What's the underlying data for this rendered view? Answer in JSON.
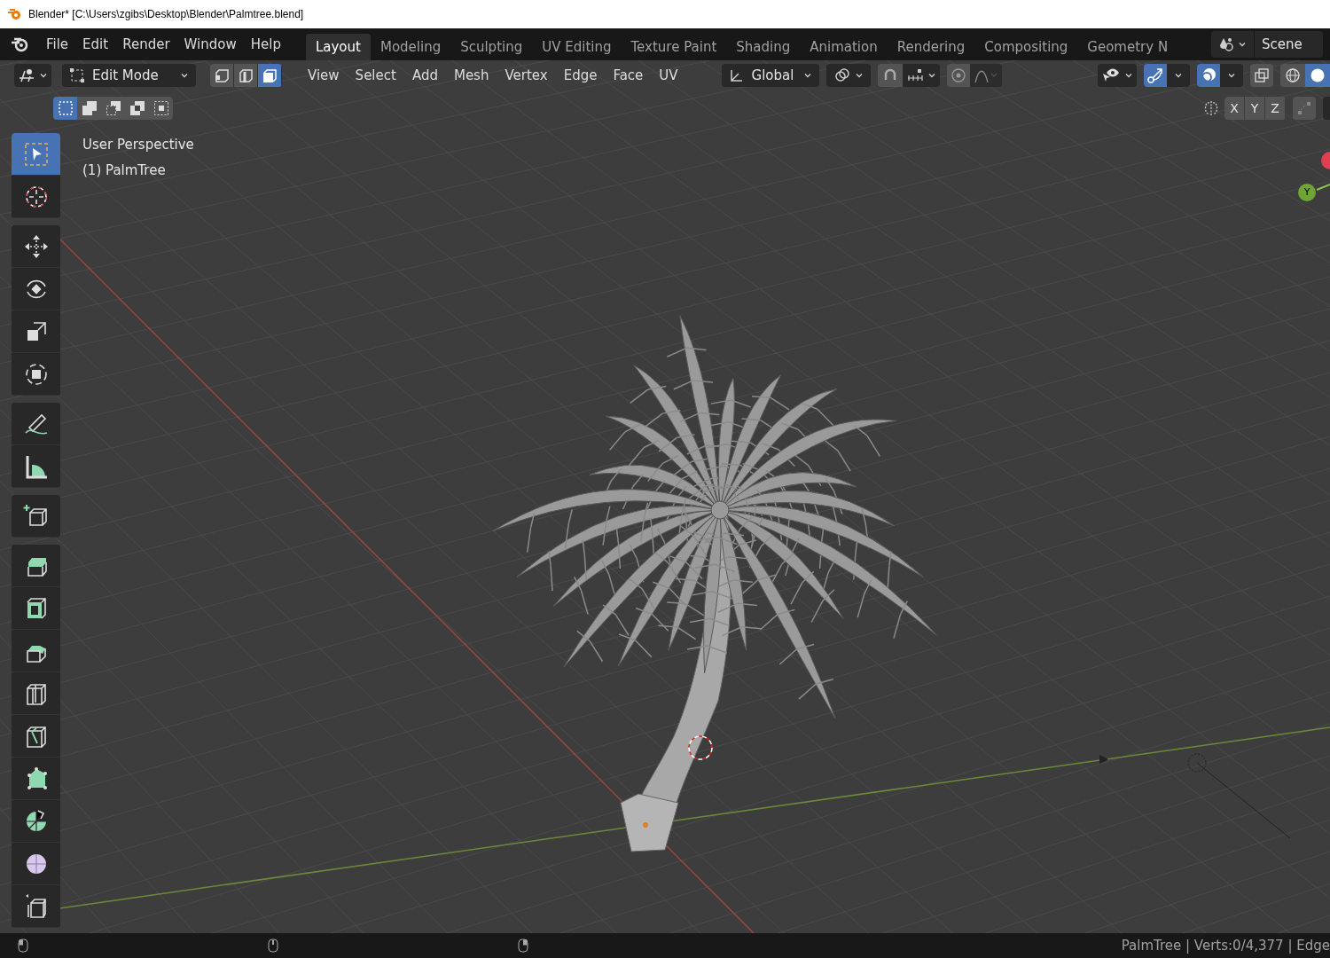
{
  "window": {
    "title": "Blender* [C:\\Users\\zgibs\\Desktop\\Blender\\Palmtree.blend]"
  },
  "menu": [
    "File",
    "Edit",
    "Render",
    "Window",
    "Help"
  ],
  "workspaces": [
    {
      "label": "Layout",
      "selected": true
    },
    {
      "label": "Modeling",
      "selected": false
    },
    {
      "label": "Sculpting",
      "selected": false
    },
    {
      "label": "UV Editing",
      "selected": false
    },
    {
      "label": "Texture Paint",
      "selected": false
    },
    {
      "label": "Shading",
      "selected": false
    },
    {
      "label": "Animation",
      "selected": false
    },
    {
      "label": "Rendering",
      "selected": false
    },
    {
      "label": "Compositing",
      "selected": false
    },
    {
      "label": "Geometry N",
      "selected": false
    }
  ],
  "scene": "Scene",
  "header": {
    "mode": "Edit Mode",
    "select_modes": [
      {
        "kind": "vertex",
        "selected": false
      },
      {
        "kind": "edge",
        "selected": false
      },
      {
        "kind": "face",
        "selected": true
      }
    ],
    "menus": [
      "View",
      "Select",
      "Add",
      "Mesh",
      "Vertex",
      "Edge",
      "Face",
      "UV"
    ],
    "orientation": "Global",
    "snap": false,
    "proportional": false,
    "gizmos": true,
    "overlays": true,
    "xray": false,
    "shading": [
      {
        "kind": "wireframe",
        "selected": false
      },
      {
        "kind": "solid",
        "selected": true
      }
    ]
  },
  "box_modes": [
    {
      "kind": "new",
      "selected": true
    },
    {
      "kind": "extend",
      "selected": false
    },
    {
      "kind": "subtract",
      "selected": false
    },
    {
      "kind": "invert",
      "selected": false
    },
    {
      "kind": "intersect",
      "selected": false
    }
  ],
  "axes": [
    "X",
    "Y",
    "Z"
  ],
  "viewport": {
    "view_name": "User Perspective",
    "object": "(1) PalmTree",
    "gizmo_axis": "Y"
  },
  "tool_groups": [
    {
      "tools": [
        {
          "kind": "select",
          "selected": true
        },
        {
          "kind": "cursor",
          "selected": false
        }
      ]
    },
    {
      "tools": [
        {
          "kind": "move",
          "selected": false
        },
        {
          "kind": "rotate",
          "selected": false
        },
        {
          "kind": "scale",
          "selected": false
        },
        {
          "kind": "transform",
          "selected": false
        }
      ]
    },
    {
      "tools": [
        {
          "kind": "annotate",
          "selected": false
        },
        {
          "kind": "measure",
          "selected": false
        }
      ]
    },
    {
      "tools": [
        {
          "kind": "add_cube",
          "selected": false
        }
      ]
    },
    {
      "tools": [
        {
          "kind": "extrude",
          "selected": false
        },
        {
          "kind": "inset",
          "selected": false
        },
        {
          "kind": "bevel",
          "selected": false
        },
        {
          "kind": "loop_cut",
          "selected": false
        },
        {
          "kind": "knife",
          "selected": false
        },
        {
          "kind": "poly_build",
          "selected": false
        },
        {
          "kind": "spin",
          "selected": false
        },
        {
          "kind": "smooth",
          "selected": false
        },
        {
          "kind": "shear",
          "selected": false
        }
      ]
    }
  ],
  "status": {
    "text": "PalmTree | Verts:0/4,377 | Edge"
  }
}
